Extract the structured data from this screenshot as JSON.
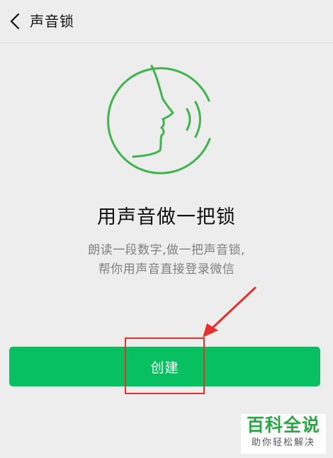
{
  "header": {
    "title": "声音锁",
    "back_icon": "chevron-left-icon"
  },
  "illustration": {
    "icon": "voice-face-icon",
    "color": "#3cb54a"
  },
  "main": {
    "title": "用声音做一把锁",
    "desc_line1": "朗读一段数字,做一把声音锁,",
    "desc_line2": "帮你用声音直接登录微信"
  },
  "create_button": {
    "label": "创建",
    "color": "#07c160"
  },
  "annotation": {
    "color": "#e8312c"
  },
  "watermark": {
    "main": "百科全说",
    "sub": "助你轻松解决"
  }
}
